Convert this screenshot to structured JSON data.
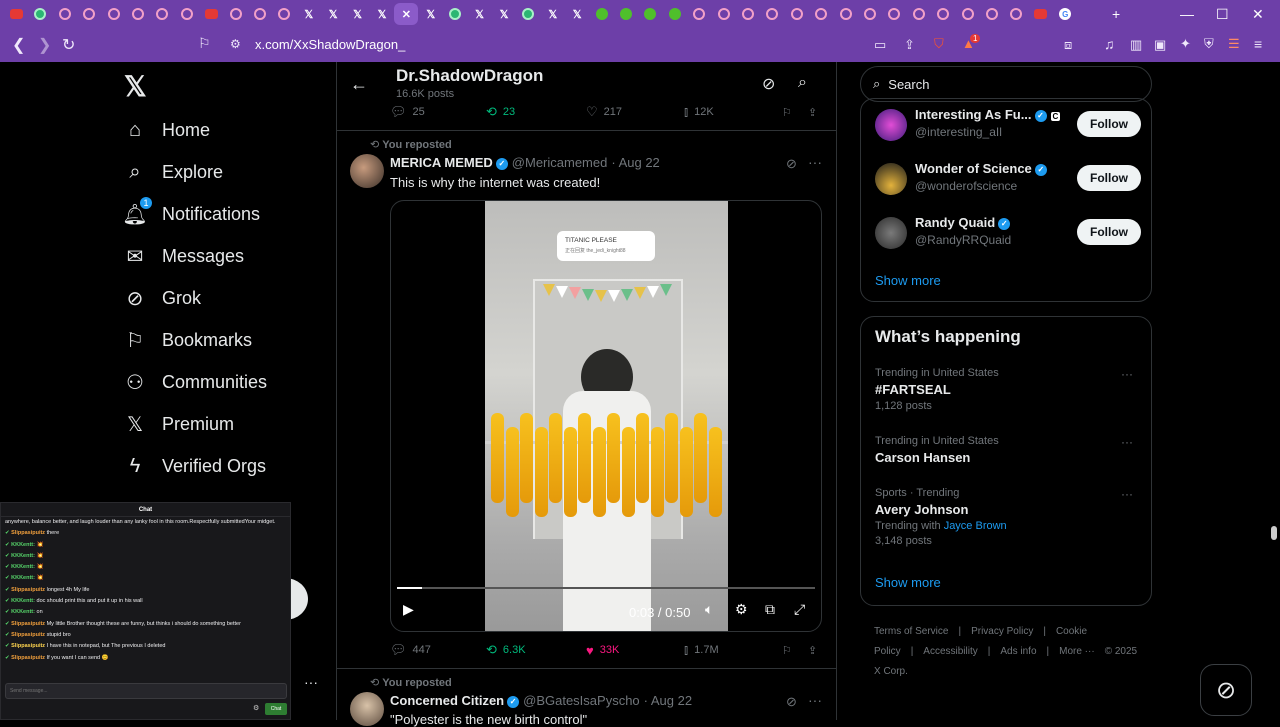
{
  "browser": {
    "tabs": [
      {
        "icon": "yt"
      },
      {
        "icon": "gr"
      },
      {
        "icon": "cr"
      },
      {
        "icon": "cr"
      },
      {
        "icon": "cr"
      },
      {
        "icon": "cr"
      },
      {
        "icon": "cr"
      },
      {
        "icon": "cr"
      },
      {
        "icon": "yt"
      },
      {
        "icon": "cr"
      },
      {
        "icon": "cr"
      },
      {
        "icon": "cr"
      },
      {
        "icon": "x"
      },
      {
        "icon": "x"
      },
      {
        "icon": "x"
      },
      {
        "icon": "x"
      },
      {
        "icon": "x",
        "active": true
      },
      {
        "icon": "x"
      },
      {
        "icon": "gr"
      },
      {
        "icon": "x"
      },
      {
        "icon": "x"
      },
      {
        "icon": "gr"
      },
      {
        "icon": "x"
      },
      {
        "icon": "x"
      },
      {
        "icon": "rumble"
      },
      {
        "icon": "rumble"
      },
      {
        "icon": "rumble"
      },
      {
        "icon": "rumble"
      },
      {
        "icon": "cr"
      },
      {
        "icon": "cr"
      },
      {
        "icon": "cr"
      },
      {
        "icon": "cr"
      },
      {
        "icon": "cr"
      },
      {
        "icon": "cr"
      },
      {
        "icon": "cr"
      },
      {
        "icon": "cr"
      },
      {
        "icon": "cr"
      },
      {
        "icon": "cr"
      },
      {
        "icon": "cr"
      },
      {
        "icon": "cr"
      },
      {
        "icon": "cr"
      },
      {
        "icon": "cr"
      },
      {
        "icon": "yt"
      },
      {
        "icon": "gl"
      }
    ],
    "url": "x.com/XxShadowDragon_",
    "brave_badge": "1"
  },
  "nav": {
    "items": [
      {
        "label": "Home",
        "icon": "⌂"
      },
      {
        "label": "Explore",
        "icon": "⌕"
      },
      {
        "label": "Notifications",
        "icon": "🔔︎",
        "badge": "1"
      },
      {
        "label": "Messages",
        "icon": "✉"
      },
      {
        "label": "Grok",
        "icon": "⊘"
      },
      {
        "label": "Bookmarks",
        "icon": "⚐"
      },
      {
        "label": "Communities",
        "icon": "⚇"
      },
      {
        "label": "Premium",
        "icon": "𝕏"
      },
      {
        "label": "Verified Orgs",
        "icon": "ϟ"
      }
    ]
  },
  "profile": {
    "name": "Dr.ShadowDragon",
    "posts": "16.6K posts"
  },
  "prev_tweet_actions": {
    "replies": "25",
    "reposts": "23",
    "likes": "217",
    "views": "12K"
  },
  "tweet": {
    "repost_label": "You reposted",
    "name": "MERICA MEMED",
    "handle": "@Mericamemed",
    "date": "· Aug 22",
    "text": "This is why the internet was created!",
    "video_caption_title": "TITANIC PLEASE",
    "video_caption_sub": "正在回复 the_jedi_knight88",
    "time": "0:03 / 0:50",
    "progress": 0.06,
    "actions": {
      "replies": "447",
      "reposts": "6.3K",
      "likes": "33K",
      "views": "1.7M"
    }
  },
  "next_tweet": {
    "repost_label": "You reposted",
    "name": "Concerned Citizen",
    "handle": "@BGatesIsaPyscho",
    "date": "· Aug 22",
    "text": "\"Polyester is the new birth control\""
  },
  "search": {
    "placeholder": "Search"
  },
  "who_to_follow": [
    {
      "name": "Interesting As Fu...",
      "handle": "@interesting_aIl",
      "button": "Follow",
      "extra": "C"
    },
    {
      "name": "Wonder of Science",
      "handle": "@wonderofscience",
      "button": "Follow"
    },
    {
      "name": "Randy Quaid",
      "handle": "@RandyRRQuaid",
      "button": "Follow"
    }
  ],
  "show_more_1": "Show more",
  "whats_happening": {
    "title": "What’s happening",
    "trends": [
      {
        "meta": "Trending in United States",
        "title": "#FARTSEAL",
        "posts": "1,128 posts"
      },
      {
        "meta": "Trending in United States",
        "title": "Carson Hansen"
      },
      {
        "meta": "Sports · Trending",
        "title": "Avery Johnson",
        "with_label": "Trending with",
        "with_link": "Jayce Brown",
        "posts": "3,148 posts"
      }
    ],
    "show_more": "Show more"
  },
  "footer": {
    "links": [
      "Terms of Service",
      "|",
      "Privacy Policy",
      "|",
      "Cookie Policy",
      "|",
      "Accessibility",
      "|",
      "Ads info",
      "|",
      "More ···",
      "© 2025 X Corp."
    ]
  },
  "chat": {
    "title": "Chat",
    "intro": "anywhere, balance better, and laugh louder than any lanky fool in this room.Respectfully submittedYour midget.",
    "messages": [
      {
        "user": "Slippasipuitz",
        "text": " there",
        "style": "u1"
      },
      {
        "user": "KKKentt:",
        "text": " 💥",
        "style": "u2"
      },
      {
        "user": "KKKentt:",
        "text": " 💥",
        "style": "u2"
      },
      {
        "user": "KKKentt:",
        "text": " 💥",
        "style": "u2"
      },
      {
        "user": "KKKentt:",
        "text": " 💥",
        "style": "u2"
      },
      {
        "user": "Slippasipuitz",
        "text": " longest 4h My life",
        "style": "u1"
      },
      {
        "user": "KKKentt:",
        "text": " doc should print this and put it up in his wall",
        "style": "u2"
      },
      {
        "user": "KKKentt:",
        "text": " on",
        "style": "u2"
      },
      {
        "user": "Slippasipuitz",
        "text": " My little Brother thought these are funny, but thinks i should do something better",
        "style": "u1"
      },
      {
        "user": "Slippasipuitz",
        "text": " stupid bro",
        "style": "u1"
      },
      {
        "user": "Slippasipuitz",
        "text": " I have this in notepad, but The previous I deleted",
        "style": "u3"
      },
      {
        "user": "Slippasipuitz",
        "text": " If you want I can send 😊",
        "style": "u1"
      }
    ],
    "input_placeholder": "Send message...",
    "button": "Chat"
  },
  "colors": {
    "accent": "#1d9bf0",
    "retweet": "#00ba7c",
    "like": "#f91880",
    "browser": "#6d3fa8"
  }
}
